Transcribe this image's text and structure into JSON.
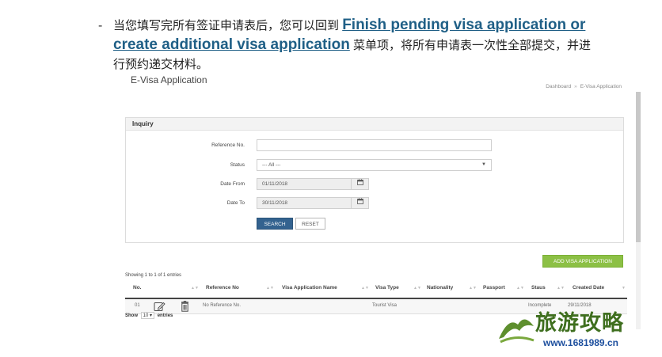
{
  "intro": {
    "dash": "-",
    "text_before": "当您填写完所有签证申请表后，您可以回到",
    "link_line1": "Finish pending visa application or",
    "link_line2": "create additional visa application",
    "text_after": "菜单项，将所有申请表一次性全部提交，并进",
    "text_line3": "行预约递交材料。"
  },
  "app": {
    "title": "E-Visa Application",
    "breadcrumb": [
      "Dashboard",
      "E-Visa Application"
    ],
    "breadcrumb_sep": "»"
  },
  "inquiry": {
    "title": "Inquiry",
    "fields": {
      "reference_label": "Reference No.",
      "reference_value": "",
      "status_label": "Status",
      "status_value": "--- All ---",
      "date_from_label": "Date From",
      "date_from_value": "01/11/2018",
      "date_to_label": "Date To",
      "date_to_value": "30/11/2018"
    },
    "search_label": "SEARCH",
    "reset_label": "RESET"
  },
  "add_button_label": "ADD VISA APPLICATION",
  "showing_text": "Showing 1 to 1 of 1 entries",
  "table": {
    "columns": [
      "No.",
      "Reference No",
      "Visa Application Name",
      "Visa Type",
      "Nationality",
      "Passport",
      "Staus",
      "Created Date"
    ],
    "rows": [
      {
        "no": "01",
        "reference": "No Reference No.",
        "name": "",
        "visa_type": "Tourist Visa",
        "nationality": "",
        "passport": "",
        "status": "Incomplete",
        "created": "29/11/2018"
      }
    ]
  },
  "show_entries": {
    "prefix": "Show",
    "value": "10 ▾",
    "suffix": "entries"
  },
  "watermark": {
    "text": "旅游攻略",
    "url": "www.1681989.cn"
  },
  "colors": {
    "link": "#1f5f86",
    "search_btn": "#33628f",
    "add_btn": "#8cc045",
    "watermark": "#3f6f1f"
  }
}
